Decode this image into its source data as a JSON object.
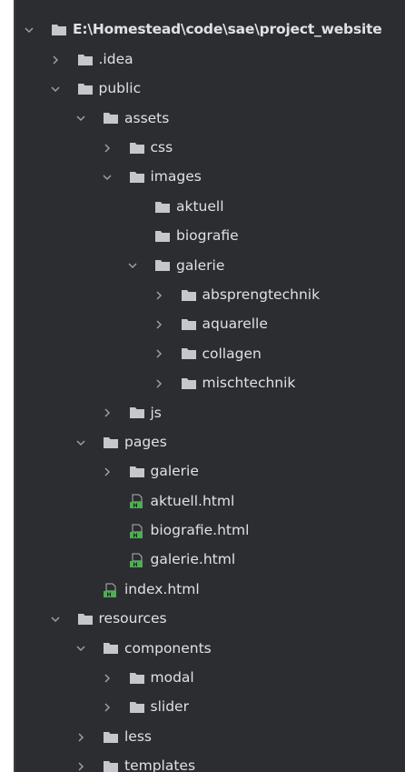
{
  "colors": {
    "panel_bg": "#2b2d30",
    "text": "#dfe1e5",
    "folder": "#c4c7cc",
    "chevron": "#9aa0a6",
    "html_icon": "#4caf50"
  },
  "tree": [
    {
      "name": "E:\\Homestead\\code\\sae\\project_website",
      "depth": 0,
      "type": "folder",
      "state": "expanded"
    },
    {
      "name": ".idea",
      "depth": 1,
      "type": "folder",
      "state": "collapsed"
    },
    {
      "name": "public",
      "depth": 1,
      "type": "folder",
      "state": "expanded"
    },
    {
      "name": "assets",
      "depth": 2,
      "type": "folder",
      "state": "expanded"
    },
    {
      "name": "css",
      "depth": 3,
      "type": "folder",
      "state": "collapsed"
    },
    {
      "name": "images",
      "depth": 3,
      "type": "folder",
      "state": "expanded"
    },
    {
      "name": "aktuell",
      "depth": 4,
      "type": "folder",
      "state": "leaf"
    },
    {
      "name": "biografie",
      "depth": 4,
      "type": "folder",
      "state": "leaf"
    },
    {
      "name": "galerie",
      "depth": 4,
      "type": "folder",
      "state": "expanded"
    },
    {
      "name": "absprengtechnik",
      "depth": 5,
      "type": "folder",
      "state": "collapsed"
    },
    {
      "name": "aquarelle",
      "depth": 5,
      "type": "folder",
      "state": "collapsed"
    },
    {
      "name": "collagen",
      "depth": 5,
      "type": "folder",
      "state": "collapsed"
    },
    {
      "name": "mischtechnik",
      "depth": 5,
      "type": "folder",
      "state": "collapsed"
    },
    {
      "name": "js",
      "depth": 3,
      "type": "folder",
      "state": "collapsed"
    },
    {
      "name": "pages",
      "depth": 2,
      "type": "folder",
      "state": "expanded"
    },
    {
      "name": "galerie",
      "depth": 3,
      "type": "folder",
      "state": "collapsed"
    },
    {
      "name": "aktuell.html",
      "depth": 3,
      "type": "html",
      "state": "leaf"
    },
    {
      "name": "biografie.html",
      "depth": 3,
      "type": "html",
      "state": "leaf"
    },
    {
      "name": "galerie.html",
      "depth": 3,
      "type": "html",
      "state": "leaf"
    },
    {
      "name": "index.html",
      "depth": 2,
      "type": "html",
      "state": "leaf"
    },
    {
      "name": "resources",
      "depth": 1,
      "type": "folder",
      "state": "expanded"
    },
    {
      "name": "components",
      "depth": 2,
      "type": "folder",
      "state": "expanded"
    },
    {
      "name": "modal",
      "depth": 3,
      "type": "folder",
      "state": "collapsed"
    },
    {
      "name": "slider",
      "depth": 3,
      "type": "folder",
      "state": "collapsed"
    },
    {
      "name": "less",
      "depth": 2,
      "type": "folder",
      "state": "collapsed"
    },
    {
      "name": "templates",
      "depth": 2,
      "type": "folder",
      "state": "collapsed"
    }
  ]
}
